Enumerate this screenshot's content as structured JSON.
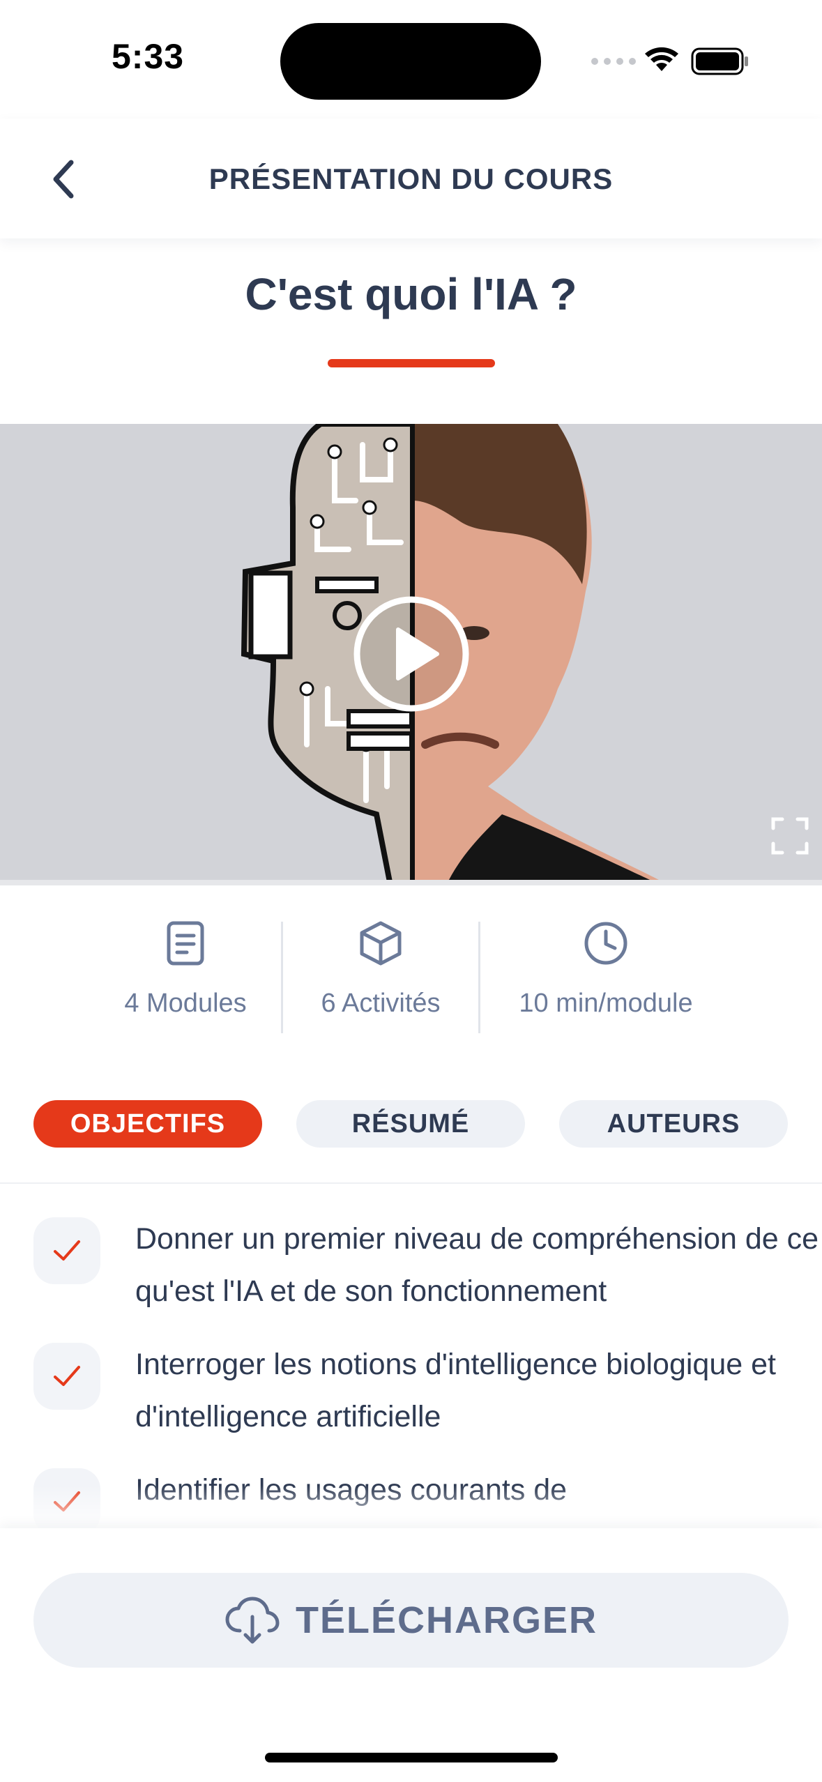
{
  "status_bar": {
    "time": "5:33"
  },
  "nav": {
    "title": "PRÉSENTATION DU COURS",
    "back_icon": "chevron-left-icon"
  },
  "course": {
    "title": "C'est quoi l'IA ?"
  },
  "video": {
    "play_icon": "play-icon",
    "fullscreen_icon": "fullscreen-icon",
    "thumbnail_desc_icon": "video-thumbnail"
  },
  "stats": [
    {
      "icon": "document-icon",
      "label": "4 Modules"
    },
    {
      "icon": "cube-icon",
      "label": "6 Activités"
    },
    {
      "icon": "clock-icon",
      "label": "10 min/module"
    }
  ],
  "tabs": [
    {
      "label": "OBJECTIFS",
      "active": true
    },
    {
      "label": "RÉSUMÉ",
      "active": false
    },
    {
      "label": "AUTEURS",
      "active": false
    }
  ],
  "objectives": [
    {
      "text": "Donner un premier niveau de compréhension de ce qu'est l'IA et de son fonctionnement"
    },
    {
      "text": "Interroger les notions d'intelligence biologique et d'intelligence artificielle"
    },
    {
      "text": "Identifier les usages courants de"
    }
  ],
  "download": {
    "label": "TÉLÉCHARGER",
    "icon": "cloud-download-icon"
  },
  "colors": {
    "accent": "#e5391a",
    "text": "#2e3a52",
    "muted": "#6b7a99",
    "chip_bg": "#eef1f6"
  }
}
